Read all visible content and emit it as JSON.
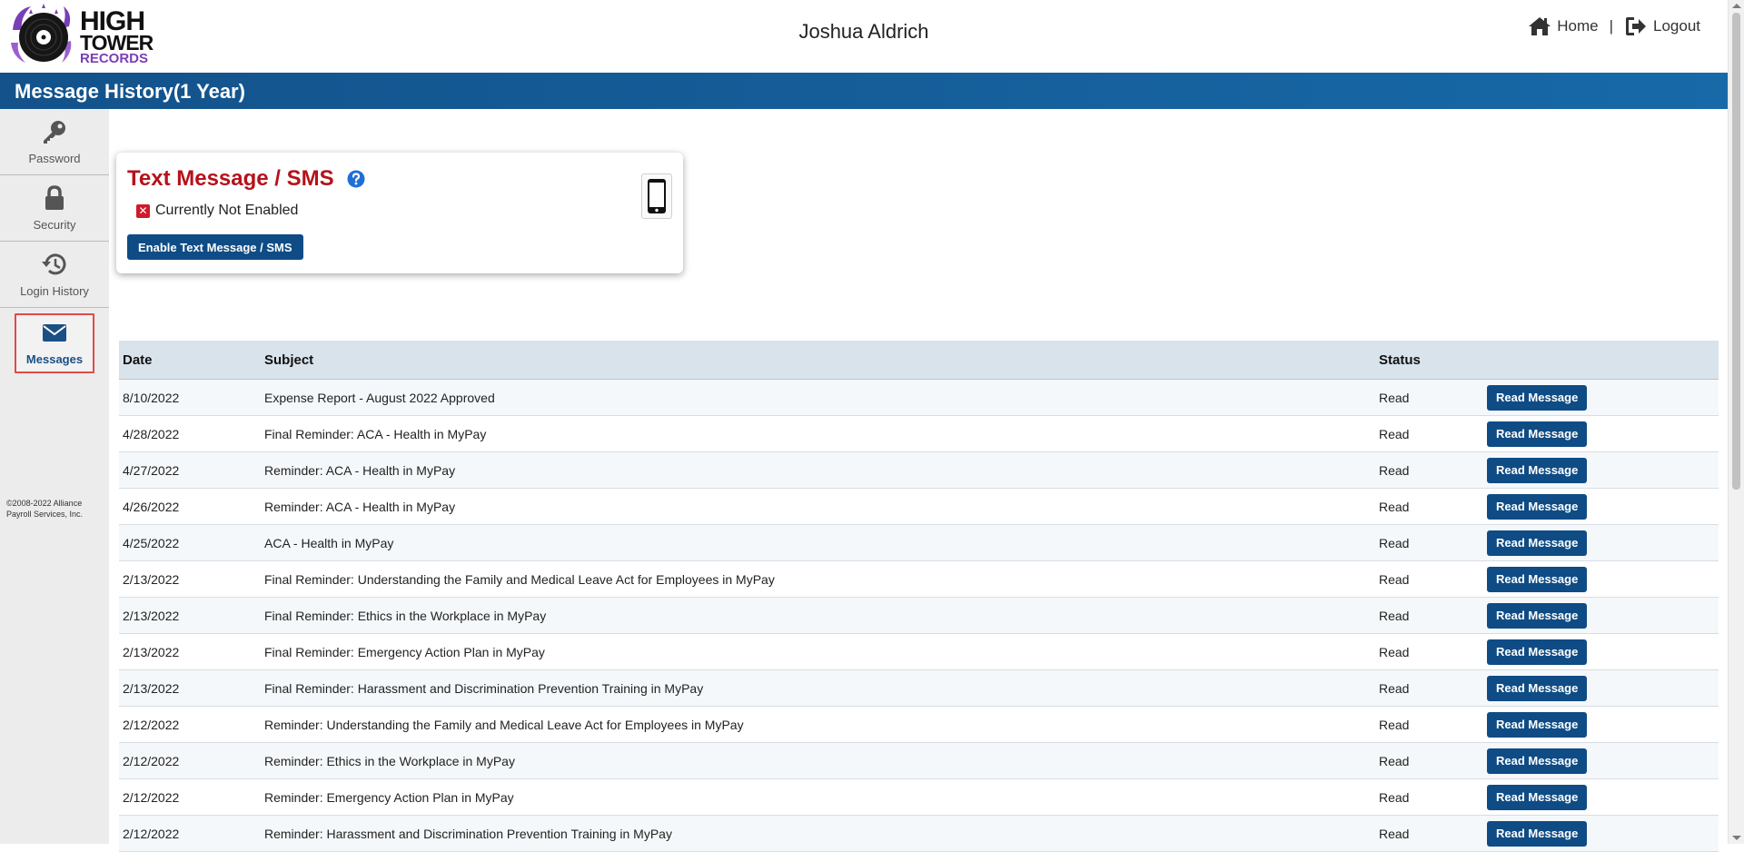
{
  "brand": {
    "line1": "HIGH",
    "line2": "TOWER",
    "line3": "RECORDS",
    "accent": "#7a3fb5"
  },
  "header": {
    "user_name": "Joshua Aldrich",
    "home_label": "Home",
    "separator": "|",
    "logout_label": "Logout",
    "home_icon": "home-icon",
    "logout_icon": "logout-icon"
  },
  "title_bar": {
    "title": "Message History(1 Year)",
    "color": "#13528b"
  },
  "sidebar": {
    "items": [
      {
        "label": "Password",
        "icon": "key-icon"
      },
      {
        "label": "Security",
        "icon": "lock-icon"
      },
      {
        "label": "Login History",
        "icon": "history-icon"
      },
      {
        "label": "Messages",
        "icon": "envelope-icon",
        "active": true
      }
    ],
    "copyright": "©2008-2022 Alliance Payroll Services, Inc."
  },
  "sms": {
    "title": "Text Message / SMS",
    "status": "Currently Not Enabled",
    "enable_label": "Enable Text Message / SMS",
    "status_icon": "x-mark-icon",
    "device_icon": "phone-icon",
    "title_color": "#b5121b"
  },
  "table": {
    "headers": {
      "date": "Date",
      "subject": "Subject",
      "status": "Status"
    },
    "button_label": "Read Message",
    "rows": [
      {
        "date": "8/10/2022",
        "subject": "Expense Report - August 2022 Approved",
        "status": "Read"
      },
      {
        "date": "4/28/2022",
        "subject": "Final Reminder: ACA - Health in MyPay",
        "status": "Read"
      },
      {
        "date": "4/27/2022",
        "subject": "Reminder: ACA - Health in MyPay",
        "status": "Read"
      },
      {
        "date": "4/26/2022",
        "subject": "Reminder: ACA - Health in MyPay",
        "status": "Read"
      },
      {
        "date": "4/25/2022",
        "subject": "ACA - Health in MyPay",
        "status": "Read"
      },
      {
        "date": "2/13/2022",
        "subject": "Final Reminder: Understanding the Family and Medical Leave Act for Employees in MyPay",
        "status": "Read"
      },
      {
        "date": "2/13/2022",
        "subject": "Final Reminder: Ethics in the Workplace in MyPay",
        "status": "Read"
      },
      {
        "date": "2/13/2022",
        "subject": "Final Reminder: Emergency Action Plan in MyPay",
        "status": "Read"
      },
      {
        "date": "2/13/2022",
        "subject": "Final Reminder: Harassment and Discrimination Prevention Training in MyPay",
        "status": "Read"
      },
      {
        "date": "2/12/2022",
        "subject": "Reminder: Understanding the Family and Medical Leave Act for Employees in MyPay",
        "status": "Read"
      },
      {
        "date": "2/12/2022",
        "subject": "Reminder: Ethics in the Workplace in MyPay",
        "status": "Read"
      },
      {
        "date": "2/12/2022",
        "subject": "Reminder: Emergency Action Plan in MyPay",
        "status": "Read"
      },
      {
        "date": "2/12/2022",
        "subject": "Reminder: Harassment and Discrimination Prevention Training in MyPay",
        "status": "Read"
      }
    ]
  }
}
